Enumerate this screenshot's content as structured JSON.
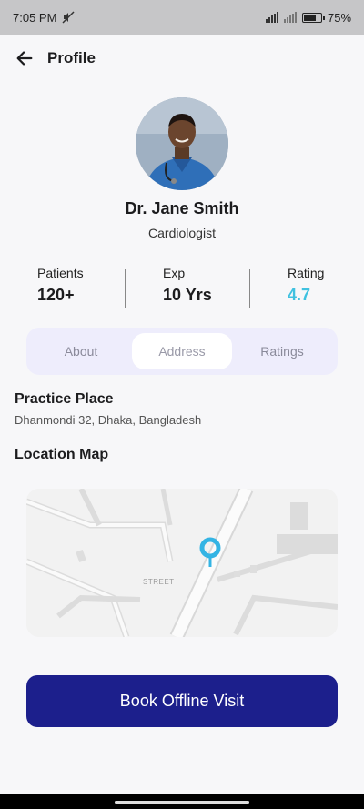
{
  "status_bar": {
    "time": "7:05 PM",
    "battery": "75"
  },
  "header": {
    "title": "Profile"
  },
  "doctor": {
    "name": "Dr. Jane Smith",
    "specialty": "Cardiologist"
  },
  "stats": {
    "patients": {
      "label": "Patients",
      "value": "120+"
    },
    "exp": {
      "label": "Exp",
      "value": "10 Yrs"
    },
    "rating": {
      "label": "Rating",
      "value": "4.7"
    }
  },
  "tabs": [
    {
      "label": "About",
      "active": false
    },
    {
      "label": "Address",
      "active": true
    },
    {
      "label": "Ratings",
      "active": false
    }
  ],
  "practice": {
    "title": "Practice Place",
    "address": "Dhanmondi 32, Dhaka, Bangladesh"
  },
  "map": {
    "title": "Location Map",
    "street_label": "STREET"
  },
  "cta": {
    "label": "Book Offline Visit"
  },
  "colors": {
    "primary": "#1c1f8c",
    "rating": "#3fc1e0",
    "tab_bg": "#eeedfc",
    "pin": "#34b4e4"
  },
  "icons": [
    "back-arrow-icon",
    "location-pin-icon",
    "signal-icon",
    "battery-icon",
    "mute-icon"
  ]
}
